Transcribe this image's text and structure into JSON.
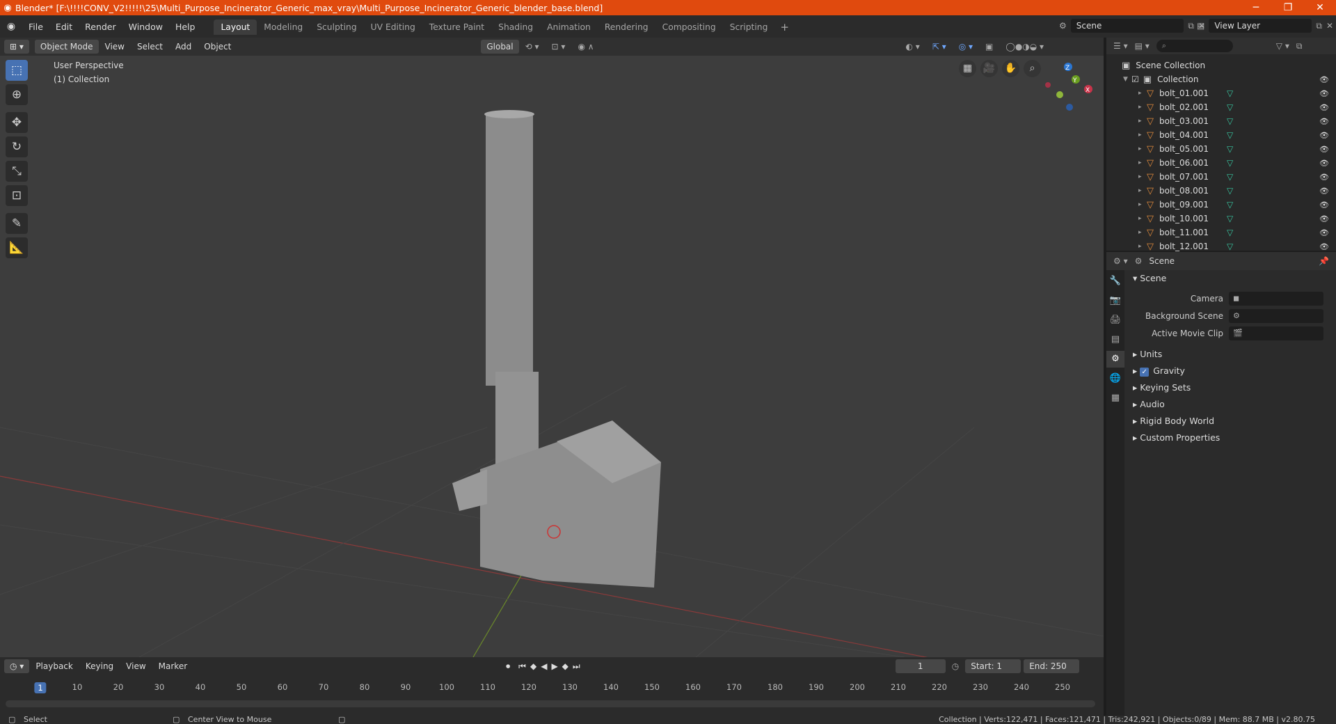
{
  "window": {
    "title": "Blender* [F:\\!!!!CONV_V2!!!!!\\25\\Multi_Purpose_Incinerator_Generic_max_vray\\Multi_Purpose_Incinerator_Generic_blender_base.blend]",
    "minimize": "─",
    "maximize": "❐",
    "close": "✕"
  },
  "menu": [
    "File",
    "Edit",
    "Render",
    "Window",
    "Help"
  ],
  "workspaces": [
    "Layout",
    "Modeling",
    "Sculpting",
    "UV Editing",
    "Texture Paint",
    "Shading",
    "Animation",
    "Rendering",
    "Compositing",
    "Scripting"
  ],
  "active_workspace": "Layout",
  "scene_selector": "Scene",
  "view_layer_selector": "View Layer",
  "viewport": {
    "mode": "Object Mode",
    "menus": [
      "View",
      "Select",
      "Add",
      "Object"
    ],
    "orientation": "Global",
    "overlay_line1": "User Perspective",
    "overlay_line2": "(1) Collection",
    "gizmo_axes": {
      "z": "Z",
      "y": "Y",
      "x": "X"
    }
  },
  "outliner": {
    "search_placeholder": "⌕",
    "root": "Scene Collection",
    "collection": "Collection",
    "items": [
      "bolt_01.001",
      "bolt_02.001",
      "bolt_03.001",
      "bolt_04.001",
      "bolt_05.001",
      "bolt_06.001",
      "bolt_07.001",
      "bolt_08.001",
      "bolt_09.001",
      "bolt_10.001",
      "bolt_11.001",
      "bolt_12.001"
    ]
  },
  "properties": {
    "header": "Scene",
    "panel": "Scene",
    "camera_label": "Camera",
    "background_scene_label": "Background Scene",
    "active_movie_clip_label": "Active Movie Clip",
    "sections": [
      "Units",
      "Gravity",
      "Keying Sets",
      "Audio",
      "Rigid Body World",
      "Custom Properties"
    ],
    "gravity_checked": true
  },
  "timeline": {
    "menus": [
      "Playback",
      "Keying",
      "View",
      "Marker"
    ],
    "current_frame": "1",
    "start_label": "Start:",
    "start": "1",
    "end_label": "End:",
    "end": "250",
    "ticks": [
      "1",
      "10",
      "20",
      "30",
      "40",
      "50",
      "60",
      "70",
      "80",
      "90",
      "100",
      "110",
      "120",
      "130",
      "140",
      "150",
      "160",
      "170",
      "180",
      "190",
      "200",
      "210",
      "220",
      "230",
      "240",
      "250"
    ]
  },
  "status": {
    "left1": "Select",
    "left2": "Center View to Mouse",
    "right": "Collection | Verts:122,471 | Faces:121,471 | Tris:242,921 | Objects:0/89 | Mem: 88.7 MB | v2.80.75"
  }
}
